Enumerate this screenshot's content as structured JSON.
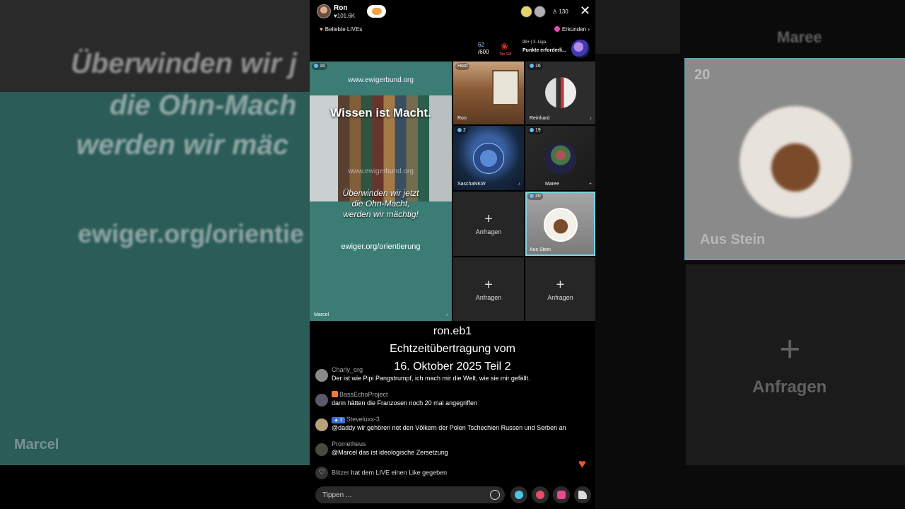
{
  "background": {
    "left_lines": [
      "Überwinden wir j",
      "die Ohn-Mach",
      "werden wir mäc",
      "ewiger.org/orientie"
    ],
    "left_label": "Marcel",
    "right_top": "Maree",
    "right_badge": "20",
    "right_name": "Aus Stein",
    "right_anfragen": "Anfragen"
  },
  "header": {
    "host_name": "Ron",
    "host_likes": "♥101.6K",
    "viewer_count": "130",
    "popular_label": "Beliebte LIVEs",
    "explore_label": "Erkunden"
  },
  "score": {
    "current": "62",
    "target": "/600",
    "rose_label": "Top Gift",
    "league": "99+ | 3. Liga",
    "league_hint": "Punkte erforderli..."
  },
  "grid": {
    "main": {
      "badge": "16",
      "url_top": "www.ewigerbund.org",
      "headline": "Wissen ist Macht.",
      "watermark": "www.ewigerbund.org",
      "slogan_1": "Überwinden wir jetzt",
      "slogan_2": "die Ohn-Macht,",
      "slogan_3": "werden wir mächtig!",
      "url_bottom": "ewiger.org/orientierung",
      "name": "Marcel"
    },
    "host": {
      "badge": "Host",
      "name": "Ron"
    },
    "reinhard": {
      "badge": "16",
      "name": "Reinhard"
    },
    "sascha": {
      "badge": "2",
      "name": "SaschaNKW"
    },
    "maree": {
      "badge": "19",
      "name": "Maree"
    },
    "stein": {
      "badge": "20",
      "name": "Aus Stein"
    },
    "request_label": "Anfragen",
    "plus": "+"
  },
  "title_overlay": {
    "line1": "ron.eb1",
    "line2": "Echtzeitübertragung vom",
    "line3": "16. Oktober 2025 Teil 2"
  },
  "comments": [
    {
      "user": "Charly_org",
      "text": "Der ist wie Pipi Pangstrumpf, ich mach mir die Welt, wie sie mir gefällt."
    },
    {
      "user": "BassEchoProject",
      "text": "dann hätten die Franzosen noch 20 mal angegriffen"
    },
    {
      "user": "Steveluxx-3",
      "rank": "2",
      "text": "@daddy wir gehören net den Völkern der Polen Tschechien Russen und Serben an"
    },
    {
      "user": "Prometheus",
      "text": "@Marcel das ist ideologische Zersetzung"
    }
  ],
  "like_note": {
    "user": "Blitzer",
    "text": "hat dem LIVE einen Like gegeben"
  },
  "input": {
    "placeholder": "Tippen ..."
  },
  "colors": {
    "accent_cyan": "#7fd3e6",
    "heart_red": "#e53935",
    "teal_bg": "#3b7c74"
  }
}
